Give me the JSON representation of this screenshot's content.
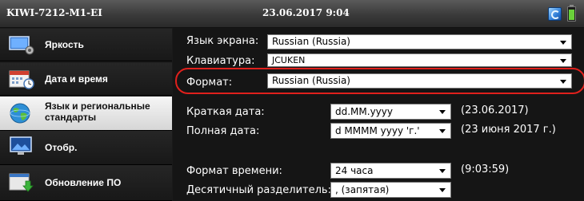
{
  "titlebar": {
    "device": "KIWI-7212-M1-EI",
    "datetime": "23.06.2017 9:04"
  },
  "sidebar": {
    "items": [
      {
        "label": "Яркость",
        "icon": "brightness-icon"
      },
      {
        "label": "Дата и время",
        "icon": "calendar-clock-icon"
      },
      {
        "label_line1": "Язык и региональные",
        "label_line2": "стандарты",
        "icon": "globe-icon",
        "active": true
      },
      {
        "label": "Отобр.",
        "icon": "display-icon"
      },
      {
        "label": "Обновление ПО",
        "icon": "software-update-icon"
      }
    ]
  },
  "settings": {
    "screen_language": {
      "label": "Язык экрана:",
      "value": "Russian (Russia)"
    },
    "keyboard": {
      "label": "Клавиатура:",
      "value": "JCUKEN"
    },
    "format": {
      "label": "Формат:",
      "value": "Russian (Russia)"
    },
    "short_date": {
      "label": "Краткая дата:",
      "value": "dd.MM.yyyy",
      "preview": "(23.06.2017)"
    },
    "long_date": {
      "label": "Полная дата:",
      "value": "d MMMM yyyy 'г.'",
      "preview": "(23 июня 2017 г.)"
    },
    "time_format": {
      "label": "Формат времени:",
      "value": "24 часа",
      "preview": "(9:03:59)"
    },
    "decimal_separator": {
      "label": "Десятичный разделитель:",
      "value": ", (запятая)"
    }
  },
  "colors": {
    "highlight": "#e0201c",
    "panel_bg": "#151515",
    "active_item_bg": "#e6e6e6"
  }
}
